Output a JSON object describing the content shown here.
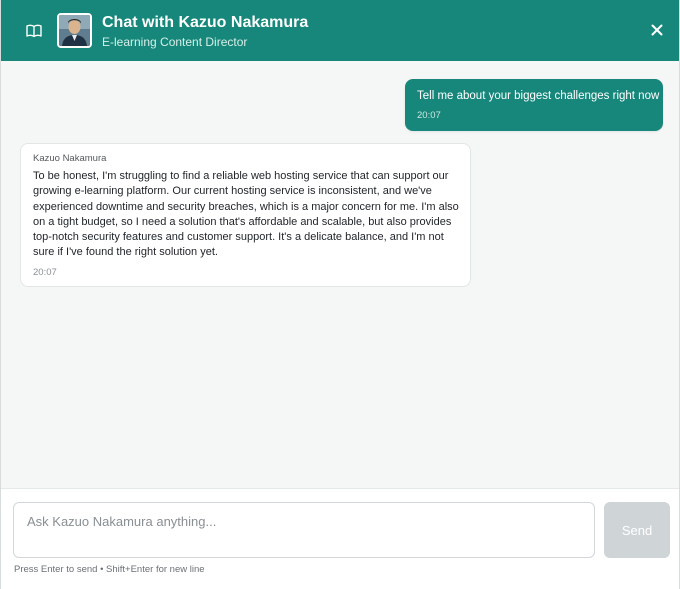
{
  "header": {
    "title": "Chat with Kazuo Nakamura",
    "subtitle": "E-learning Content Director",
    "book_icon": "book-open-icon",
    "close_icon": "close-icon"
  },
  "messages": [
    {
      "role": "user",
      "text": "Tell me about your biggest challenges right now",
      "time": "20:07"
    },
    {
      "role": "assistant",
      "sender": "Kazuo Nakamura",
      "text": "To be honest, I'm struggling to find a reliable web hosting service that can support our growing e-learning platform. Our current hosting service is inconsistent, and we've experienced downtime and security breaches, which is a major concern for me. I'm also on a tight budget, so I need a solution that's affordable and scalable, but also provides top-notch security features and customer support. It's a delicate balance, and I'm not sure if I've found the right solution yet.",
      "time": "20:07"
    }
  ],
  "composer": {
    "placeholder": "Ask Kazuo Nakamura anything...",
    "value": "",
    "send_label": "Send",
    "hint": "Press Enter to send • Shift+Enter for new line"
  },
  "colors": {
    "accent": "#16877a",
    "send_disabled": "#cfd4d7",
    "background": "#f5f6f6"
  }
}
